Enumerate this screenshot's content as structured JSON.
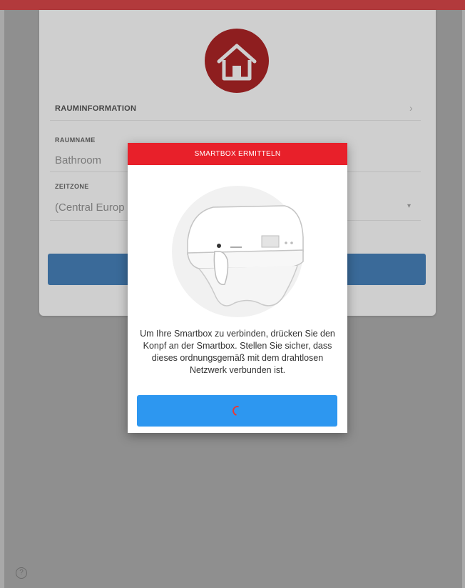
{
  "background_screen": {
    "section_title": "RAUMINFORMATION",
    "room_name_label": "RAUMNAME",
    "room_name_value": "Bathroom",
    "timezone_label": "ZEITZONE",
    "timezone_value": "(Central Europ",
    "house_icon": "house-icon"
  },
  "modal": {
    "header": "SMARTBOX ERMITTELN",
    "message": "Um Ihre Smartbox zu verbinden, drücken Sie den Konpf an der Smartbox. Stellen Sie sicher, dass dieses ordnungsgemäß mit dem drahtlosen Netzwerk verbunden ist.",
    "illustration_icon": "smartbox-illustration",
    "button_icon": "spinner-icon"
  },
  "footer": {
    "help_icon": "help-icon",
    "help_glyph": "?"
  },
  "colors": {
    "topbar": "#b23a3c",
    "modal_header": "#e8202a",
    "modal_button": "#2d97f0",
    "house_circle": "#8e1e1f"
  }
}
